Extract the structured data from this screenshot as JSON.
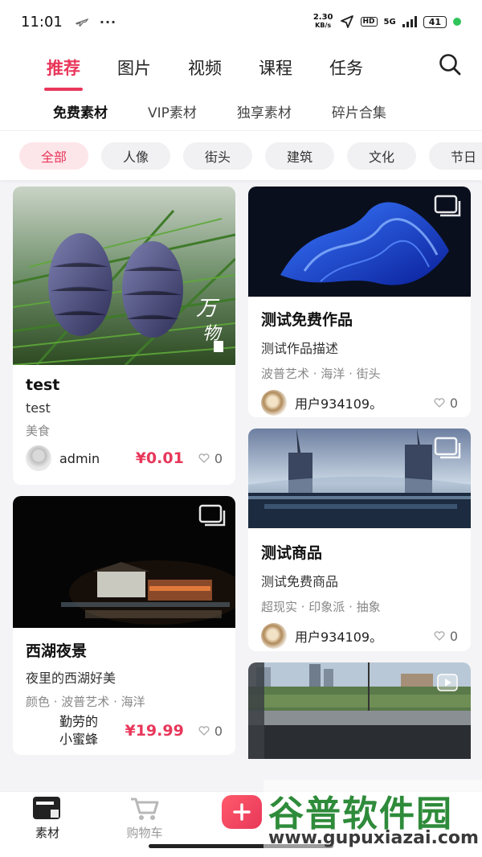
{
  "status": {
    "time": "11:01",
    "speed_value": "2.30",
    "speed_unit": "KB/s",
    "hd": "HD",
    "network": "5G",
    "battery": "41"
  },
  "topnav": {
    "tabs": [
      "推荐",
      "图片",
      "视频",
      "课程",
      "任务"
    ],
    "active": "推荐"
  },
  "subnav": {
    "items": [
      "免费素材",
      "VIP素材",
      "独享素材",
      "碎片合集"
    ]
  },
  "filters": [
    "全部",
    "人像",
    "街头",
    "建筑",
    "文化",
    "节日"
  ],
  "cards": {
    "c1": {
      "title": "test",
      "desc": "test",
      "tags": "美食",
      "user": "admin",
      "price": "¥0.01",
      "likes": "0"
    },
    "c2": {
      "title": "西湖夜景",
      "desc": "夜里的西湖好美",
      "tags": "颜色 · 波普艺术 · 海洋",
      "user": "勤劳的\n小蜜蜂",
      "price": "¥19.99",
      "likes": "0"
    },
    "c3": {
      "title": "测试免费作品",
      "desc": "测试作品描述",
      "tags": "波普艺术 · 海洋 · 街头",
      "user": "用户934109。",
      "likes": "0"
    },
    "c4": {
      "title": "测试商品",
      "desc": "测试免费商品",
      "tags": "超现实 · 印象派 · 抽象",
      "user": "用户934109。",
      "likes": "0"
    }
  },
  "bottom": {
    "materials": "素材",
    "cart": "购物车"
  },
  "watermark": {
    "brand": "谷普软件园",
    "url": "www.gupuxiazai.com"
  },
  "colors": {
    "accent": "#e8375a",
    "chip_active_bg": "#fde6ea",
    "page_bg": "#f4f4f6"
  }
}
